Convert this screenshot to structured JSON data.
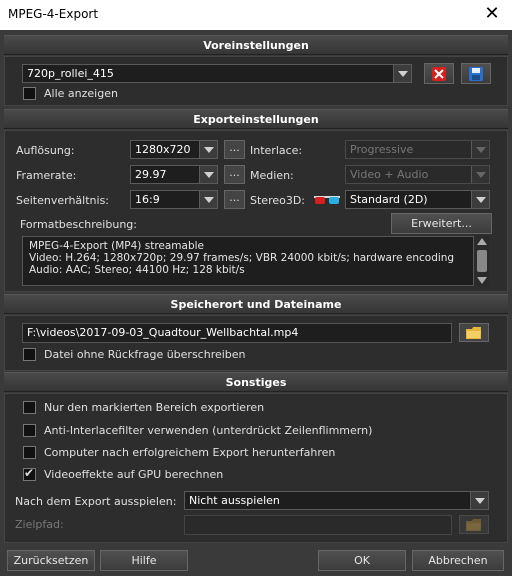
{
  "window": {
    "title": "MPEG-4-Export",
    "close_glyph": "✕"
  },
  "presets": {
    "header": "Voreinstellungen",
    "selected": "720p_rollei_415",
    "show_all_label": "Alle anzeigen",
    "show_all_checked": false
  },
  "export_settings": {
    "header": "Exporteinstellungen",
    "resolution": {
      "label": "Auflösung:",
      "value": "1280x720"
    },
    "framerate": {
      "label": "Framerate:",
      "value": "29.97"
    },
    "aspect_ratio": {
      "label": "Seitenverhältnis:",
      "value": "16:9"
    },
    "interlace": {
      "label": "Interlace:",
      "value": "Progressive"
    },
    "media": {
      "label": "Medien:",
      "value": "Video + Audio"
    },
    "stereo3d": {
      "label": "Stereo3D:",
      "value": "Standard (2D)"
    },
    "dots_label": "...",
    "format_description_label": "Formatbeschreibung:",
    "advanced_button": "Erweitert...",
    "description_lines": [
      "MPEG-4-Export (MP4) streamable",
      "Video: H.264; 1280x720p; 29.97 frames/s; VBR 24000 kbit/s; hardware encoding",
      "Audio: AAC; Stereo; 44100 Hz; 128 kbit/s"
    ]
  },
  "save_location": {
    "header": "Speicherort und Dateiname",
    "path": "F:\\videos\\2017-09-03_Quadtour_Wellbachtal.mp4",
    "overwrite_label": "Datei ohne Rückfrage überschreiben",
    "overwrite_checked": false
  },
  "misc": {
    "header": "Sonstiges",
    "options": [
      {
        "label": "Nur den markierten Bereich exportieren",
        "checked": false
      },
      {
        "label": "Anti-Interlacefilter verwenden (unterdrückt Zeilenflimmern)",
        "checked": false
      },
      {
        "label": "Computer nach erfolgreichem Export herunterfahren",
        "checked": false
      },
      {
        "label": "Videoeffekte auf GPU berechnen",
        "checked": true
      }
    ],
    "after_export_label": "Nach dem Export ausspielen:",
    "after_export_value": "Nicht ausspielen",
    "target_path_label": "Zielpfad:",
    "target_path_value": ""
  },
  "footer": {
    "reset": "Zurücksetzen",
    "help": "Hilfe",
    "ok": "OK",
    "cancel": "Abbrechen"
  },
  "colors": {
    "delete_red": "#d62020",
    "save_blue": "#2a6fc9",
    "folder_yellow": "#e8b53a"
  }
}
